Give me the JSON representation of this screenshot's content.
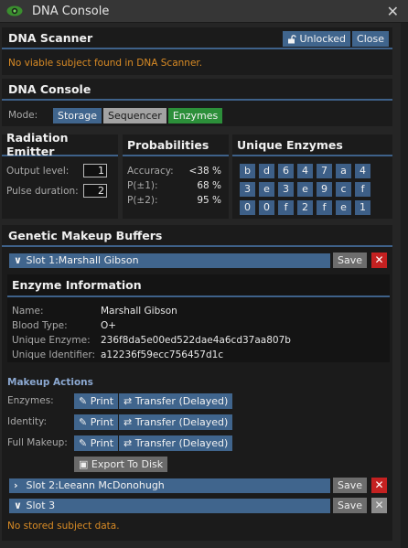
{
  "window": {
    "title": "DNA Console",
    "close_symbol": "✕"
  },
  "scanner": {
    "title": "DNA Scanner",
    "unlocked_label": "Unlocked",
    "close_label": "Close",
    "message": "No viable subject found in DNA Scanner."
  },
  "console": {
    "title": "DNA Console",
    "mode_label": "Mode:",
    "modes": [
      "Storage",
      "Sequencer",
      "Enzymes"
    ],
    "active_mode": "Enzymes"
  },
  "emitter": {
    "title": "Radiation Emitter",
    "output_label": "Output level:",
    "output_value": "1",
    "pulse_label": "Pulse duration:",
    "pulse_value": "2"
  },
  "probabilities": {
    "title": "Probabilities",
    "rows": [
      {
        "label": "Accuracy:",
        "value": "<38 %"
      },
      {
        "label": "P(±1):",
        "value": "68 %"
      },
      {
        "label": "P(±2):",
        "value": "95 %"
      }
    ]
  },
  "unique_enzymes": {
    "title": "Unique Enzymes",
    "rows": [
      [
        "b",
        "d",
        "6",
        "4",
        "7",
        "a",
        "4"
      ],
      [
        "3",
        "e",
        "3",
        "e",
        "9",
        "c",
        "f"
      ],
      [
        "0",
        "0",
        "f",
        "2",
        "f",
        "e",
        "1"
      ]
    ]
  },
  "buffers": {
    "title": "Genetic Makeup Buffers",
    "save_label": "Save",
    "slot1": {
      "label": "Slot 1:Marshall Gibson"
    },
    "slot2": {
      "label": "Slot 2:Leeann McDonohugh"
    },
    "slot3": {
      "label": "Slot 3",
      "empty_message": "No stored subject data."
    }
  },
  "enzyme_info": {
    "title": "Enzyme Information",
    "name_label": "Name:",
    "name": "Marshall Gibson",
    "blood_label": "Blood Type:",
    "blood": "O+",
    "ue_label": "Unique Enzyme:",
    "ue": "236f8da5e00ed522dae4a6cd37aa807b",
    "ui_label": "Unique Identifier:",
    "ui": "a12236f59ecc756457d1c"
  },
  "makeup_actions": {
    "title": "Makeup Actions",
    "enzymes_label": "Enzymes:",
    "identity_label": "Identity:",
    "full_label": "Full Makeup:",
    "print_label": "Print",
    "transfer_label": "Transfer (Delayed)",
    "export_label": "Export To Disk"
  },
  "colors": {
    "accent_blue": "#40658d",
    "warning_orange": "#d98b25",
    "danger_red": "#c42121",
    "active_green": "#2c8f3a"
  }
}
